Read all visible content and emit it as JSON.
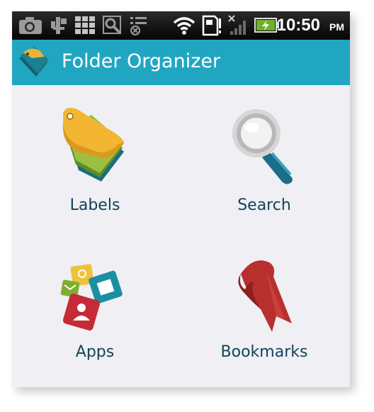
{
  "status_bar": {
    "time": "10:50",
    "ampm": "PM",
    "icons": [
      "camera-icon",
      "usb-icon",
      "grid-apps-icon",
      "search-notification-icon",
      "list-notification-icon",
      "wifi-icon",
      "sd-card-icon",
      "no-signal-icon",
      "battery-charging-icon"
    ]
  },
  "title_bar": {
    "title": "Folder Organizer",
    "icon": "folder-organizer-icon",
    "accent": "#21a6c2"
  },
  "menu": {
    "items": [
      {
        "label": "Labels",
        "icon": "labels-tag-icon"
      },
      {
        "label": "Search",
        "icon": "magnifier-icon"
      },
      {
        "label": "Apps",
        "icon": "apps-icon"
      },
      {
        "label": "Bookmarks",
        "icon": "bookmark-ribbon-icon"
      }
    ]
  }
}
